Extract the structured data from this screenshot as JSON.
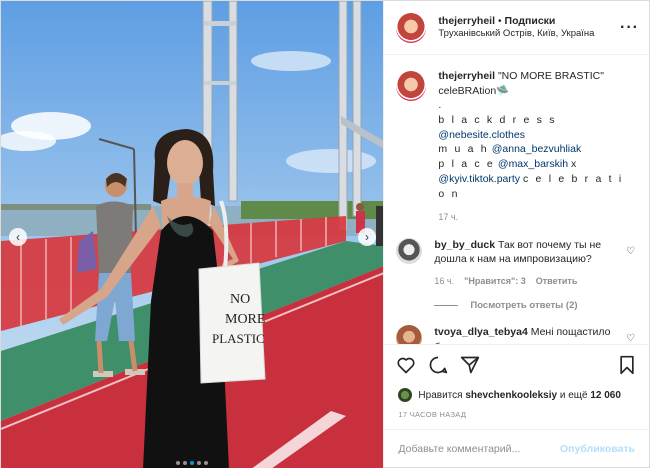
{
  "media": {
    "bag_text_1": "NO",
    "bag_text_2": "MORE",
    "bag_text_3": "PLASTIC",
    "carousel": {
      "count": 5,
      "active": 3
    },
    "prev_icon": "chevron-left-icon",
    "next_icon": "chevron-right-icon"
  },
  "header": {
    "username": "thejerryheil",
    "separator": "•",
    "follow_label": "Подписки",
    "location": "Труханівський Острів, Київ, Україна",
    "more_icon": "more-horizontal-icon"
  },
  "caption": {
    "username": "thejerryheil",
    "line1": "\"NO MORE BRASTIC\"",
    "line2": "celeBRAtion",
    "line2_emoji": "🛸",
    "line3": ".",
    "line4_prefix": "b l a c k d r e s s",
    "line4_link": "@nebesite.clothes",
    "line5_prefix": "m u a h",
    "line5_link": "@anna_bezvuhliak",
    "line6_prefix": "p l a c e",
    "line6_link": "@max_barskih",
    "line6_suffix": "x",
    "line7_link": "@kyiv.tiktok.party",
    "line7_suffix": "c e l e b r a t i o n",
    "time": "17 ч."
  },
  "comments": [
    {
      "username": "by_by_duck",
      "text": "Так вот почему ты не дошла к нам на импровизацию?",
      "time": "16 ч.",
      "likes": "\"Нравится\": 3",
      "reply": "Ответить"
    },
    {
      "username": "tvoya_dlya_tebya4",
      "text": "Мені пощастило бути твоєю"
    }
  ],
  "view_replies": "Посмотреть ответы (2)",
  "actions": {
    "like_icon": "heart-icon",
    "comment_icon": "comment-icon",
    "share_icon": "share-icon",
    "save_icon": "bookmark-icon"
  },
  "likes": {
    "prefix": "Нравится",
    "user": "shevchenkooleksiy",
    "middle": "и ещё",
    "count": "12 060"
  },
  "ago": "17 ЧАСОВ НАЗАД",
  "add_comment": {
    "placeholder": "Добавьте комментарий...",
    "publish": "Опубликовать"
  },
  "colors": {
    "link": "#00376b",
    "muted": "#8e8e8e",
    "publish_disabled": "#b2dffc",
    "bridge_rail": "#d8343a",
    "bike_lane": "#c8303e",
    "walk_lane": "#3f8f6b"
  }
}
